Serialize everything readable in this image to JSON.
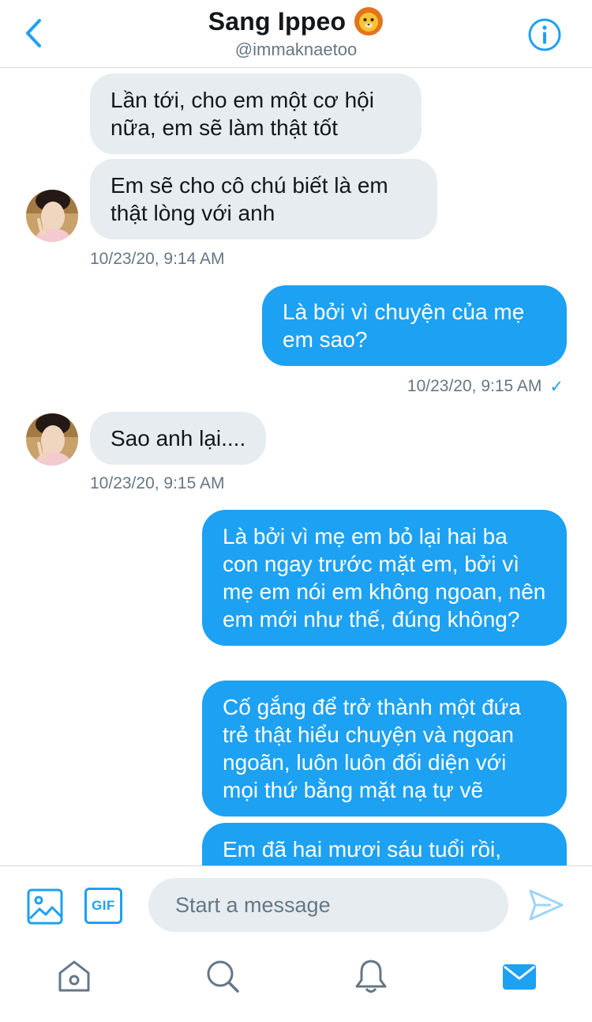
{
  "header": {
    "title": "Sang Ippeo",
    "title_emoji": "🦁",
    "handle": "@immaknaetoo",
    "icons": {
      "back": "chevron-left-icon",
      "info": "info-icon"
    }
  },
  "messages": [
    {
      "id": "m1",
      "direction": "incoming",
      "text": "Lần tới, cho em một cơ hội nữa, em sẽ làm thật tốt"
    },
    {
      "id": "m2",
      "direction": "incoming",
      "text": "Em sẽ cho cô chú biết là em thật lòng với anh"
    },
    {
      "id": "t1",
      "timestamp": "10/23/20, 9:14 AM"
    },
    {
      "id": "m3",
      "direction": "outgoing",
      "text": "Là bởi vì chuyện của mẹ em sao?"
    },
    {
      "id": "t2",
      "timestamp": "10/23/20, 9:15 AM",
      "read_receipt": "✓"
    },
    {
      "id": "m4",
      "direction": "incoming",
      "text": "Sao anh lại...."
    },
    {
      "id": "t3",
      "timestamp": "10/23/20, 9:15 AM"
    },
    {
      "id": "m5",
      "direction": "outgoing",
      "text": "Là bởi vì mẹ em bỏ lại hai ba con ngay trước mặt em, bởi vì mẹ em nói em không ngoan, nên em mới như thế, đúng không?"
    },
    {
      "id": "m6",
      "direction": "outgoing",
      "text": "Cố gắng để trở thành một đứa trẻ thật hiểu chuyện và ngoan ngoãn, luôn luôn đối diện với mọi thứ bằng mặt nạ tự vẽ"
    },
    {
      "id": "m7",
      "direction": "outgoing",
      "text": "Em đã hai mươi sáu tuổi rồi,"
    }
  ],
  "composer": {
    "placeholder": "Start a message",
    "gif_label": "GIF",
    "icons": {
      "image": "image-icon",
      "send": "send-icon"
    }
  },
  "tabbar": {
    "items": [
      "home-icon",
      "search-icon",
      "notifications-icon",
      "messages-icon"
    ],
    "active": "messages-icon"
  },
  "colors": {
    "accent": "#1da1f2",
    "incoming_bubble": "#e6ecf0",
    "secondary_text": "#657786",
    "divider": "#d6dbdf"
  }
}
